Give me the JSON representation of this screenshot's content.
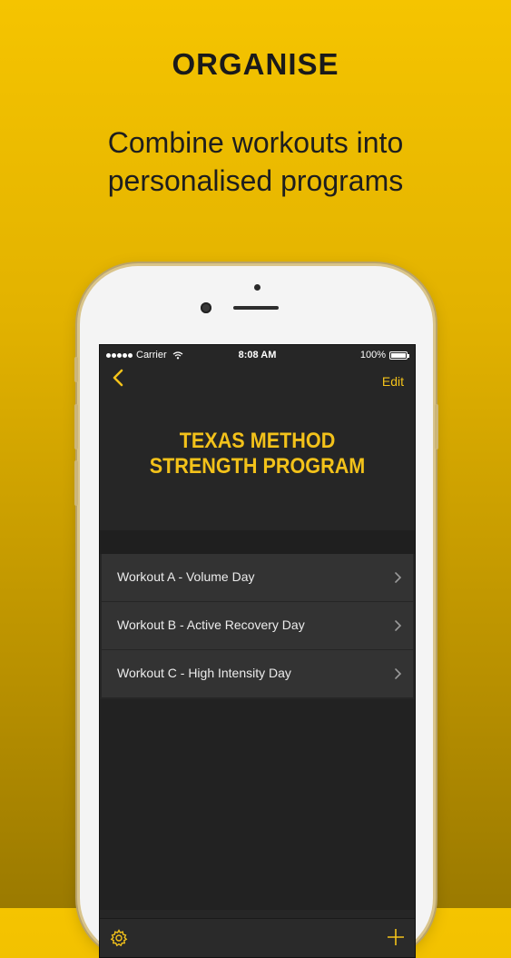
{
  "promo": {
    "headline": "ORGANISE",
    "subtitle_line1": "Combine workouts into",
    "subtitle_line2": "personalised programs"
  },
  "status_bar": {
    "carrier": "Carrier",
    "time": "8:08 AM",
    "battery": "100%"
  },
  "nav": {
    "back_icon": "chevron-left-icon",
    "edit_label": "Edit"
  },
  "program": {
    "title_line1": "TEXAS METHOD",
    "title_line2": "STRENGTH PROGRAM"
  },
  "workouts": [
    {
      "label": "Workout A - Volume Day"
    },
    {
      "label": "Workout B - Active Recovery Day"
    },
    {
      "label": "Workout C - High Intensity Day"
    }
  ],
  "toolbar": {
    "settings_icon": "gear-icon",
    "add_icon": "plus-icon"
  },
  "colors": {
    "accent": "#f3c21a",
    "screen_bg": "#262626",
    "row_bg": "#333333"
  }
}
